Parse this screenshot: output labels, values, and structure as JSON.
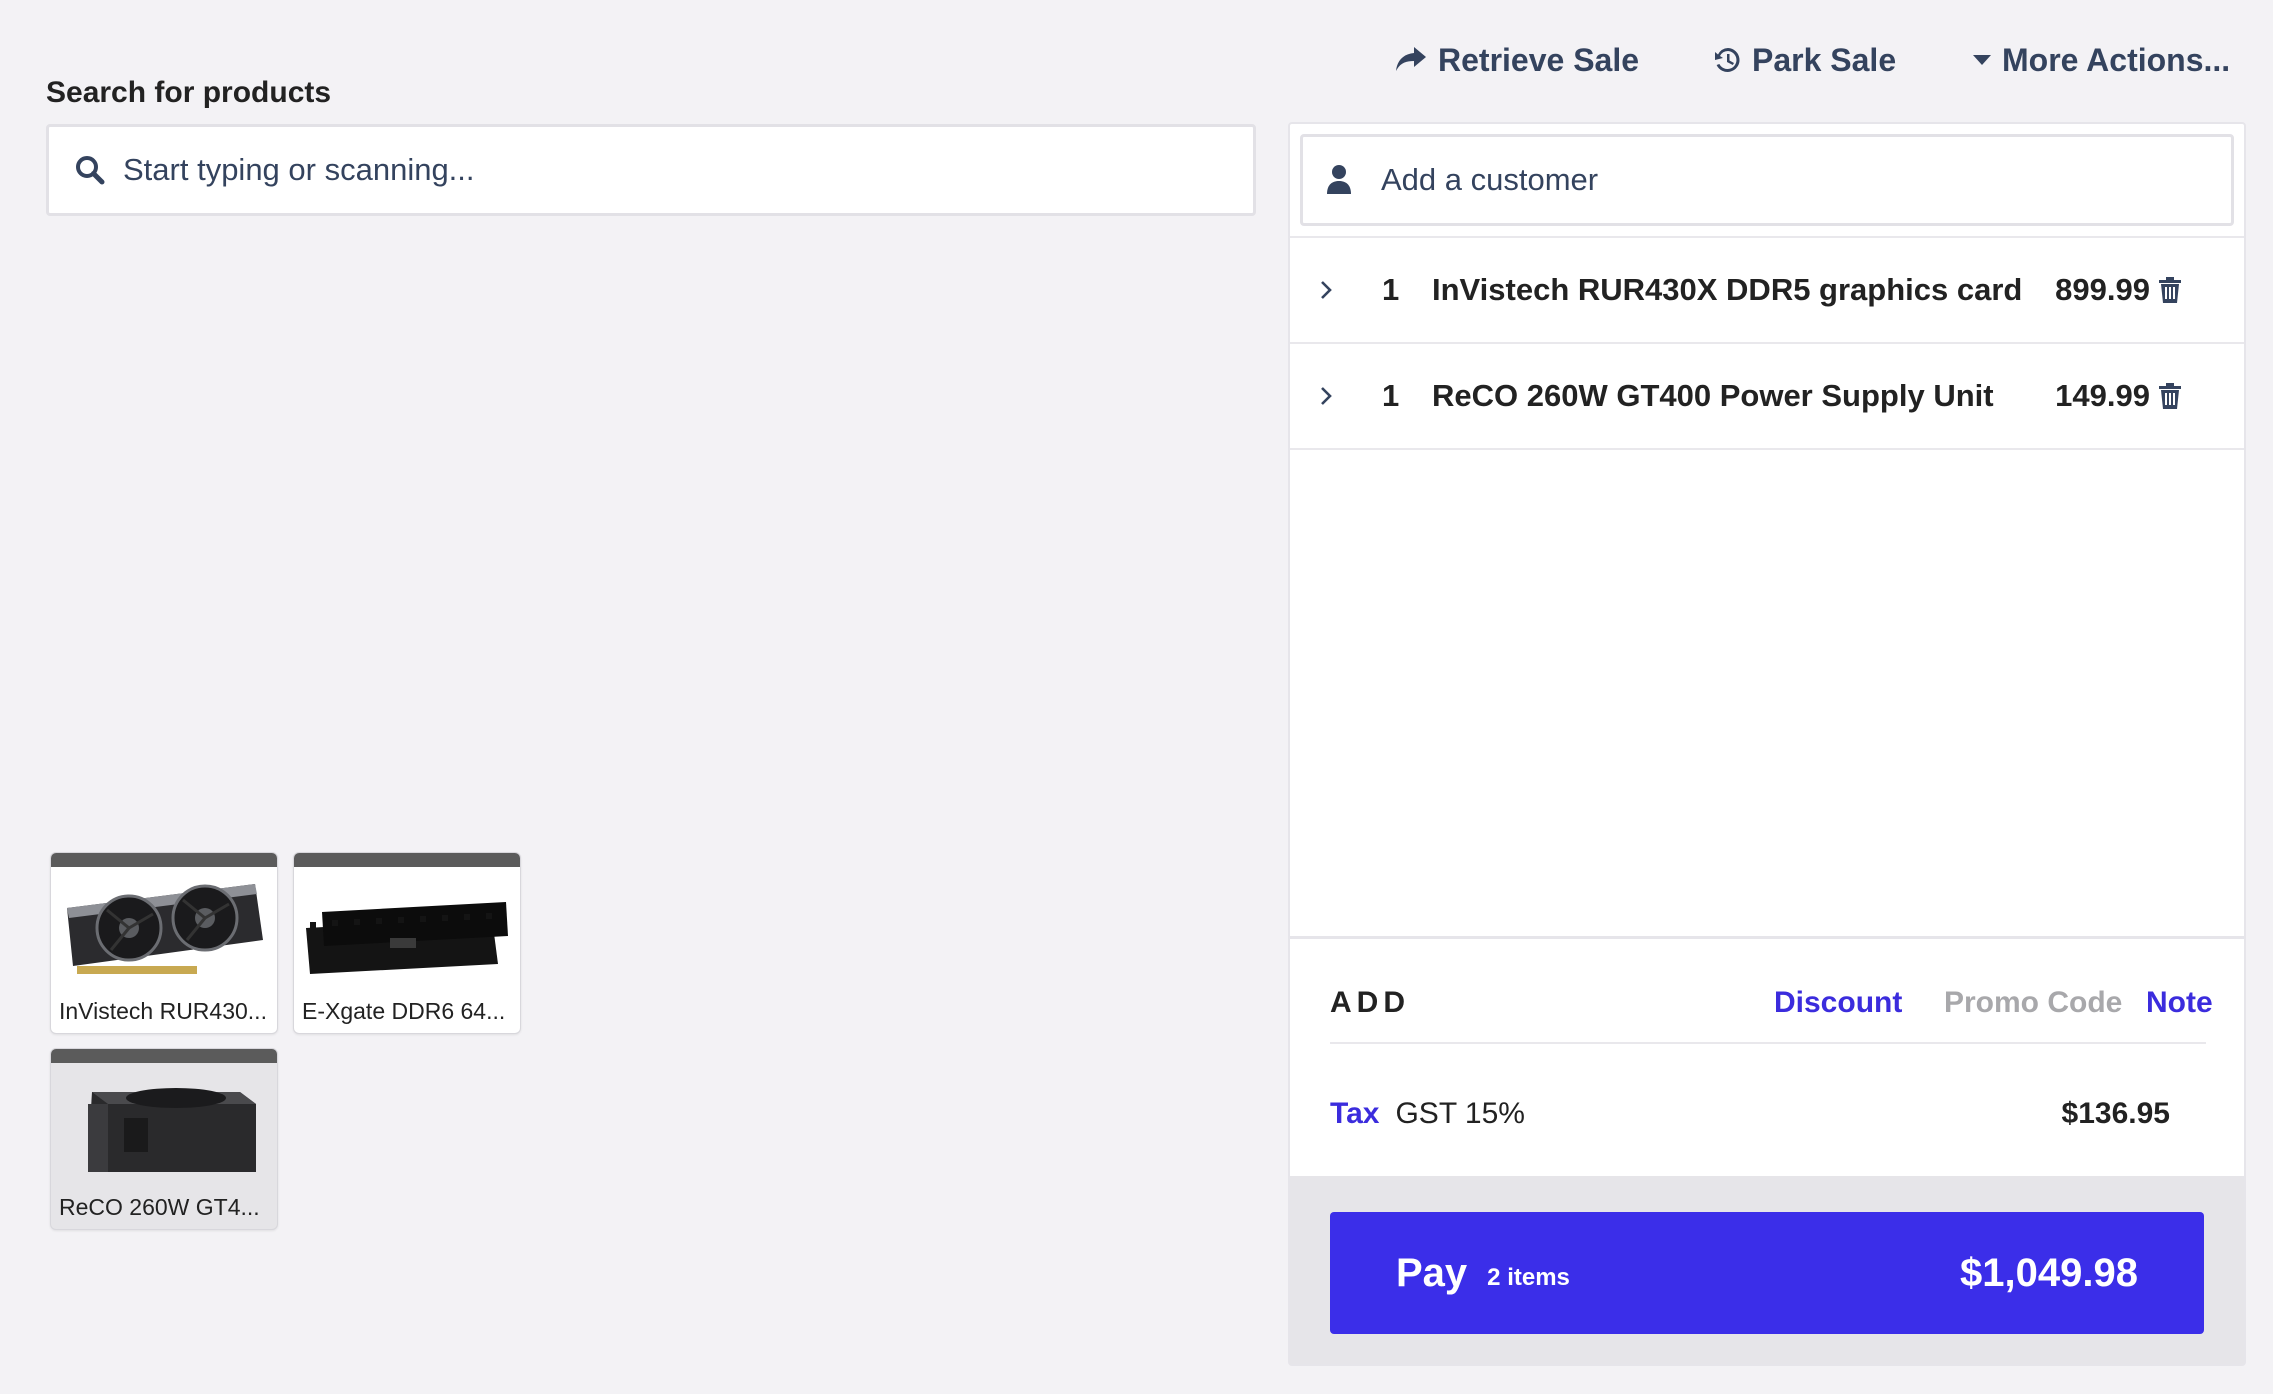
{
  "header": {
    "retrieve_sale": "Retrieve Sale",
    "park_sale": "Park Sale",
    "more_actions": "More Actions..."
  },
  "search": {
    "heading": "Search for products",
    "placeholder": "Start typing or scanning..."
  },
  "quick_keys": [
    {
      "label": "InVistech RUR430...",
      "icon": "graphics-card-image"
    },
    {
      "label": "E-Xgate DDR6 64...",
      "icon": "memory-module-image"
    },
    {
      "label": "ReCO 260W GT4...",
      "icon": "power-supply-image"
    }
  ],
  "sale": {
    "customer_placeholder": "Add a customer",
    "items": [
      {
        "qty": "1",
        "name": "InVistech RUR430X DDR5 graphics card",
        "price": "899.99"
      },
      {
        "qty": "1",
        "name": "ReCO 260W GT400 Power Supply Unit",
        "price": "149.99"
      }
    ],
    "add": {
      "label": "ADD",
      "discount": "Discount",
      "promo_code": "Promo Code",
      "note": "Note"
    },
    "tax": {
      "label": "Tax",
      "name": "GST 15%",
      "amount": "$136.95"
    },
    "pay": {
      "label": "Pay",
      "count": "2 items",
      "total": "$1,049.98"
    }
  },
  "colors": {
    "accent": "#3b2ee9",
    "link": "#3b2cdd",
    "nav_text": "#34435e",
    "muted": "#a8a8ab"
  }
}
